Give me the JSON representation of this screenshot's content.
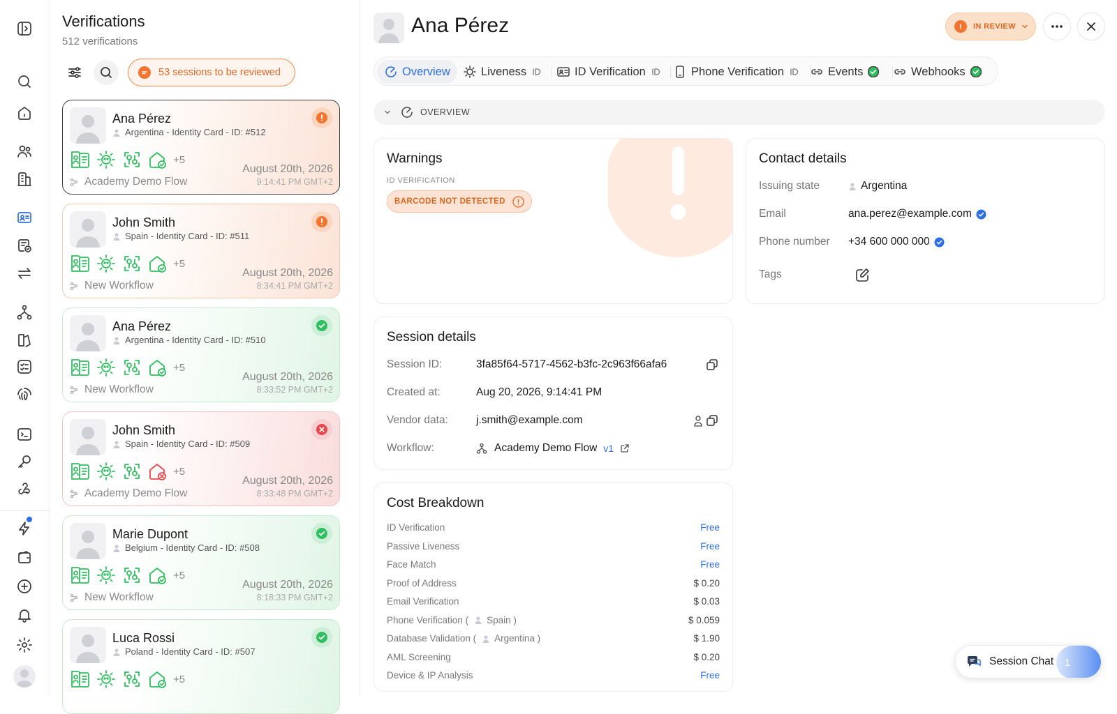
{
  "list": {
    "title": "Verifications",
    "count": "512 verifications",
    "review_pill": "53 sessions to be reviewed"
  },
  "cards": [
    {
      "name": "Ana Pérez",
      "meta": "Argentina - Identity Card - ID: #512",
      "more": "+5",
      "flow": "Academy Demo Flow",
      "date": "August 20th, 2026",
      "time": "9:14:41 PM GMT+2",
      "status": "warning"
    },
    {
      "name": "John Smith",
      "meta": "Spain - Identity Card - ID: #511",
      "more": "+5",
      "flow": "New Workflow",
      "date": "August 20th, 2026",
      "time": "8:34:41 PM GMT+2",
      "status": "warning"
    },
    {
      "name": "Ana Pérez",
      "meta": "Argentina - Identity Card - ID: #510",
      "more": "+5",
      "flow": "New Workflow",
      "date": "August 20th, 2026",
      "time": "8:33:52 PM GMT+2",
      "status": "approved"
    },
    {
      "name": "John Smith",
      "meta": "Spain - Identity Card - ID: #509",
      "more": "+5",
      "flow": "Academy Demo Flow",
      "date": "August 20th, 2026",
      "time": "8:33:48 PM GMT+2",
      "status": "declined"
    },
    {
      "name": "Marie Dupont",
      "meta": "Belgium - Identity Card - ID: #508",
      "more": "+5",
      "flow": "New Workflow",
      "date": "August 20th, 2026",
      "time": "8:18:33 PM GMT+2",
      "status": "approved"
    },
    {
      "name": "Luca Rossi",
      "meta": "Poland - Identity Card - ID: #507",
      "more": "+5",
      "flow": "",
      "date": "",
      "time": "",
      "status": "approved"
    }
  ],
  "detail": {
    "name": "Ana Pérez",
    "status_label": "IN REVIEW",
    "tabs": [
      {
        "label": "Overview"
      },
      {
        "label": "Liveness"
      },
      {
        "label": "ID Verification"
      },
      {
        "label": "Phone Verification"
      },
      {
        "label": "Events"
      },
      {
        "label": "Webhooks"
      }
    ],
    "overview_label": "OVERVIEW",
    "warnings": {
      "title": "Warnings",
      "section": "ID VERIFICATION",
      "badge": "BARCODE NOT DETECTED"
    },
    "contact": {
      "title": "Contact details",
      "issuing_state_label": "Issuing state",
      "issuing_state": "Argentina",
      "email_label": "Email",
      "email": "ana.perez@example.com",
      "phone_label": "Phone number",
      "phone": "+34 600 000 000",
      "tags_label": "Tags"
    },
    "session": {
      "title": "Session details",
      "id_label": "Session ID:",
      "id": "3fa85f64-5717-4562-b3fc-2c963f66afa6",
      "created_label": "Created at:",
      "created": "Aug 20, 2026, 9:14:41 PM",
      "vendor_label": "Vendor data:",
      "vendor": "j.smith@example.com",
      "workflow_label": "Workflow:",
      "workflow": "Academy Demo Flow",
      "workflow_version": "v1"
    },
    "cost": {
      "title": "Cost Breakdown",
      "items": [
        {
          "label": "ID Verification",
          "value": "Free"
        },
        {
          "label": "Passive Liveness",
          "value": "Free"
        },
        {
          "label": "Face Match",
          "value": "Free"
        },
        {
          "label": "Proof of Address",
          "value": "$ 0.20"
        },
        {
          "label": "Email Verification",
          "value": "$ 0.03"
        },
        {
          "label": "Phone Verification (",
          "country": "Spain )",
          "value": "$ 0.059"
        },
        {
          "label": "Database Validation (",
          "country": "Argentina )",
          "value": "$ 1.90"
        },
        {
          "label": "AML Screening",
          "value": "$ 0.20"
        },
        {
          "label": "Device & IP Analysis",
          "value": "Free"
        }
      ]
    }
  },
  "chat": {
    "label": "Session Chat",
    "count": "1"
  },
  "colors": {
    "accent": "#2f6fe4",
    "warning": "#f3742e",
    "success": "#2fbf60",
    "danger": "#e5484d"
  }
}
